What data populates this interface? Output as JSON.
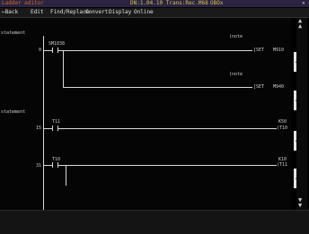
{
  "title_bar": {
    "app_title": "Ladder editor",
    "project_info": "DN:1.04.10 Trans:Rec.M68",
    "status": "OBOx",
    "close_glyph": "✕"
  },
  "menu": {
    "back": "←Back",
    "items": [
      "Edit",
      "Find/Replace",
      "Convert",
      "Display",
      "Online"
    ]
  },
  "ladder": {
    "block1": {
      "statement": "statement",
      "contact_device": "SM1038",
      "step_number": "0",
      "rung1": {
        "note": "(note",
        "coil_cmd": "[SET",
        "coil_device": "M910"
      },
      "rung2": {
        "note": "(note",
        "coil_cmd": "[SET",
        "coil_device": "M940"
      }
    },
    "block2": {
      "statement": "statement",
      "rung1": {
        "step": "15",
        "contact": "T11",
        "coil": "(T10",
        "coil_label": "K50"
      },
      "rung2": {
        "step": "31",
        "contact": "T10",
        "coil": "(T11",
        "coil_label": "K10"
      }
    }
  },
  "scrollbar": {
    "up_glyph": "▲",
    "down_glyph": "▼"
  }
}
